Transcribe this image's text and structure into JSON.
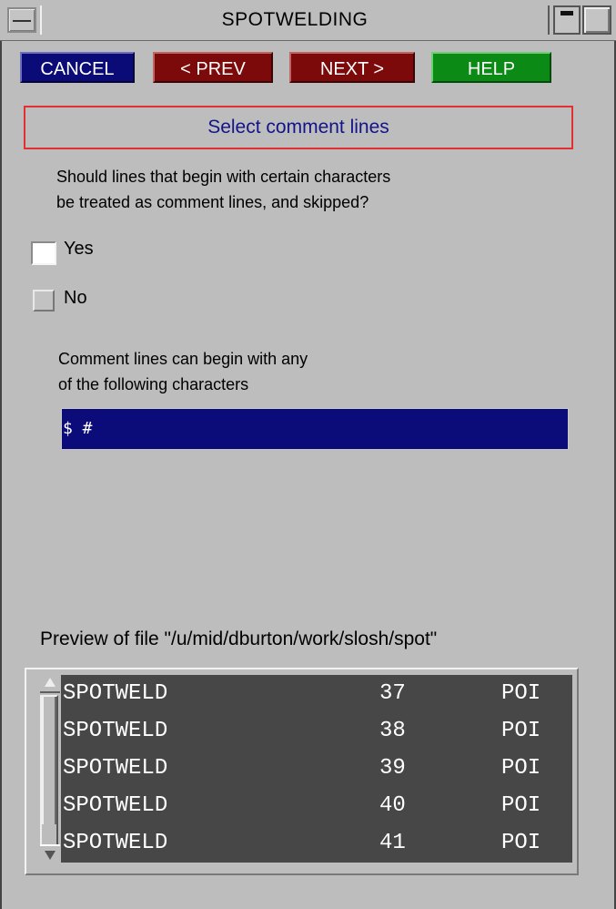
{
  "window": {
    "title": "SPOTWELDING"
  },
  "toolbar": {
    "cancel_label": "CANCEL",
    "prev_label": "< PREV",
    "next_label": "NEXT >",
    "help_label": "HELP"
  },
  "colors": {
    "cancel": "#0b0b78",
    "prev_next": "#7c0a0a",
    "help": "#0b8a16",
    "heading_text": "#14148a",
    "heading_border": "#e03030",
    "input_bg": "#0b0b7a",
    "preview_bg": "#474747"
  },
  "panel": {
    "heading": "Select comment lines",
    "question_line1": "Should lines that begin with certain characters",
    "question_line2": "be treated as comment lines, and skipped?",
    "options": [
      {
        "label": "Yes",
        "checked": true
      },
      {
        "label": "No",
        "checked": false
      }
    ],
    "comment_line1": "Comment lines can begin with any",
    "comment_line2": "of the following characters",
    "comment_chars": "$ #"
  },
  "preview": {
    "label": "Preview of file \"/u/mid/dburton/work/slosh/spot\"",
    "rows": [
      {
        "c1": "SPOTWELD",
        "c2": "37",
        "c3": "POI"
      },
      {
        "c1": "SPOTWELD",
        "c2": "38",
        "c3": "POI"
      },
      {
        "c1": "SPOTWELD",
        "c2": "39",
        "c3": "POI"
      },
      {
        "c1": "SPOTWELD",
        "c2": "40",
        "c3": "POI"
      },
      {
        "c1": "SPOTWELD",
        "c2": "41",
        "c3": "POI"
      }
    ]
  }
}
